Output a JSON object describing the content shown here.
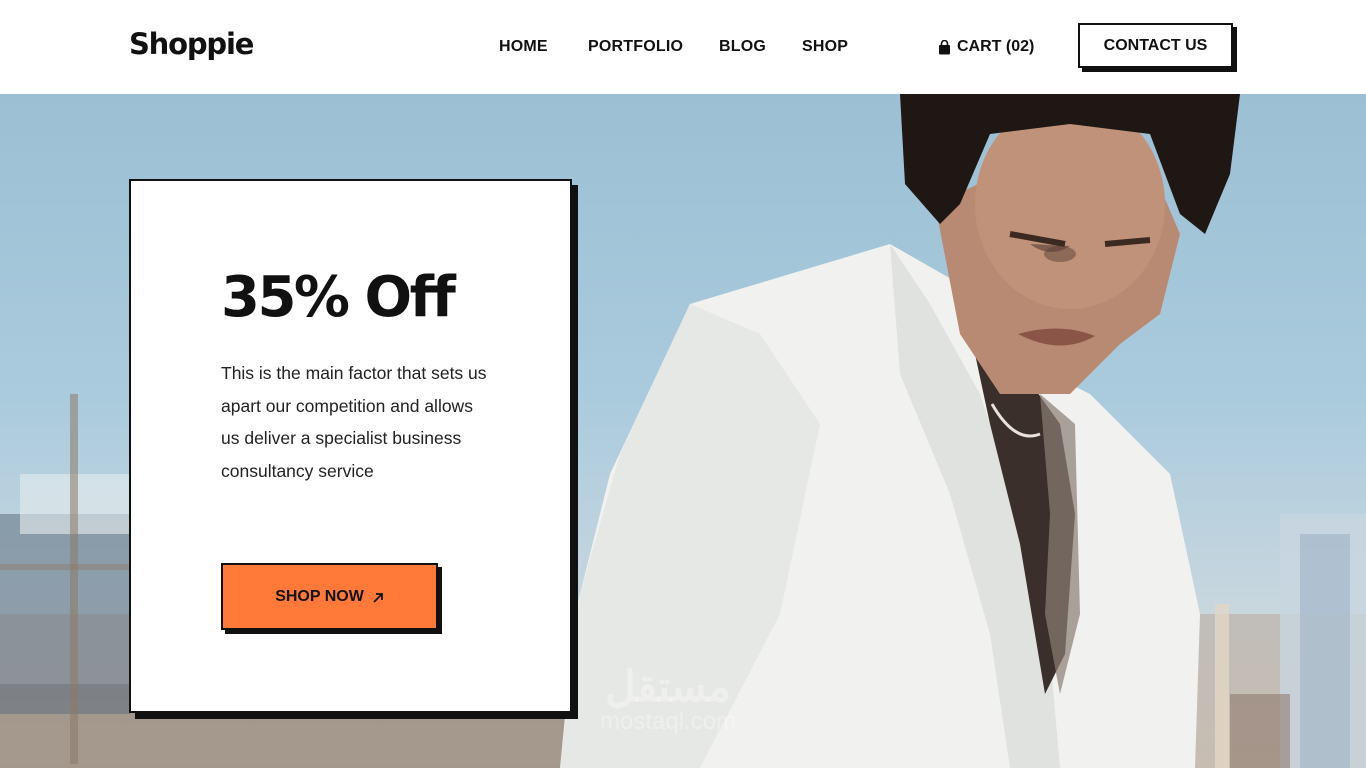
{
  "header": {
    "logo": "Shoppie",
    "nav": {
      "home": "HOME",
      "portfolio": "PORTFOLIO",
      "blog": "BLOG",
      "shop": "SHOP"
    },
    "cart_label": "CART (02)",
    "contact_label": "CONTACT US"
  },
  "hero": {
    "promo": {
      "title": "35% Off",
      "description": "This is the main factor that sets us apart our competition and allows us deliver a specialist business consultancy service",
      "button_label": "SHOP NOW"
    },
    "watermark": {
      "arabic": "مستقل",
      "latin": "mostaql.com"
    }
  },
  "icons": {
    "cart": "shopping-bag-icon",
    "shop_now": "arrow-up-right-icon"
  },
  "colors": {
    "accent": "#ff7a38",
    "ink": "#111111",
    "sky": "#a4c6da"
  }
}
